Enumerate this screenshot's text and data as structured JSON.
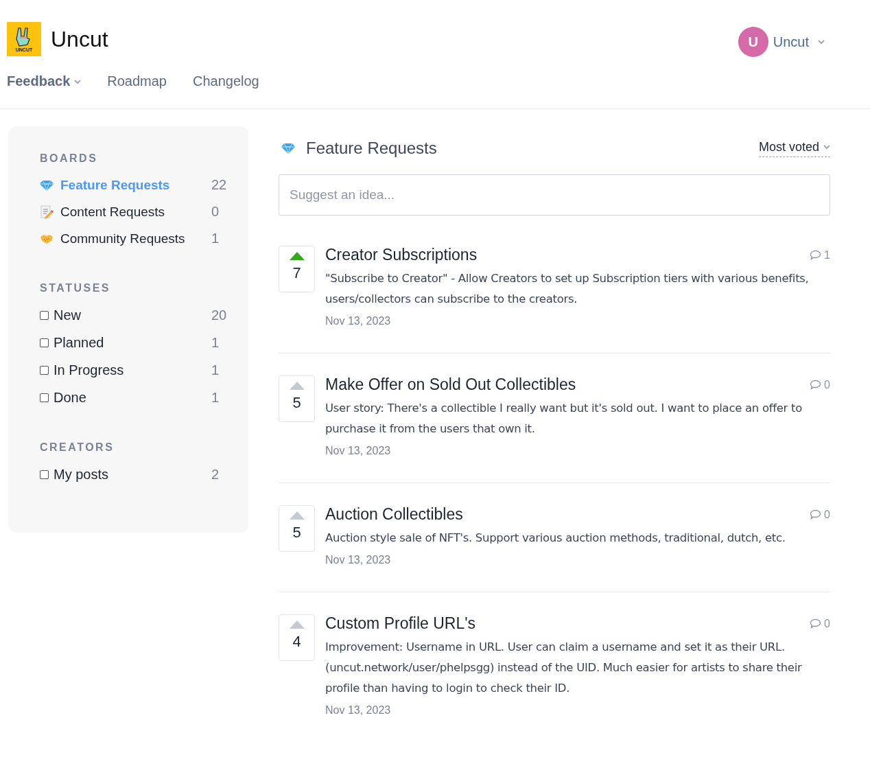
{
  "header": {
    "logo_text": "UNCUT",
    "title": "Uncut",
    "user": {
      "initial": "U",
      "name": "Uncut"
    }
  },
  "nav": [
    {
      "label": "Feedback",
      "selected": true,
      "dropdown": true
    },
    {
      "label": "Roadmap",
      "selected": false,
      "dropdown": false
    },
    {
      "label": "Changelog",
      "selected": false,
      "dropdown": false
    }
  ],
  "sidebar": {
    "sections": [
      {
        "title": "BOARDS",
        "kind": "board",
        "items": [
          {
            "label": "Feature Requests",
            "count": "22",
            "selected": true
          },
          {
            "label": "Content Requests",
            "count": "0",
            "selected": false
          },
          {
            "label": "Community Requests",
            "count": "1",
            "selected": false
          }
        ]
      },
      {
        "title": "STATUSES",
        "kind": "filter",
        "items": [
          {
            "label": "New",
            "count": "20",
            "checked": false
          },
          {
            "label": "Planned",
            "count": "1",
            "checked": false
          },
          {
            "label": "In Progress",
            "count": "1",
            "checked": false
          },
          {
            "label": "Done",
            "count": "1",
            "checked": false
          }
        ]
      },
      {
        "title": "CREATORS",
        "kind": "filter",
        "items": [
          {
            "label": "My posts",
            "count": "2",
            "checked": false
          }
        ]
      }
    ]
  },
  "board": {
    "title": "Feature Requests",
    "sort": "Most voted",
    "search": {
      "placeholder": "Suggest an idea..."
    }
  },
  "posts": [
    {
      "title": "Creator Subscriptions",
      "votes": "7",
      "voted": true,
      "comments": "1",
      "body": "\"Subscribe to Creator\" - Allow Creators to set up Subscription tiers with various benefits, users/collectors can subscribe to the creators.",
      "date": "Nov 13, 2023"
    },
    {
      "title": "Make Offer on Sold Out Collectibles",
      "votes": "5",
      "voted": false,
      "comments": "0",
      "body": "User story: There's a collectible I really want but it's sold out. I want to place an offer to purchase it from the users that own it.",
      "date": "Nov 13, 2023"
    },
    {
      "title": "Auction Collectibles",
      "votes": "5",
      "voted": false,
      "comments": "0",
      "body": "Auction style sale of NFT's. Support various auction methods, traditional, dutch, etc.",
      "date": "Nov 13, 2023"
    },
    {
      "title": "Custom Profile URL's",
      "votes": "4",
      "voted": false,
      "comments": "0",
      "body": "Improvement: Username in URL. User can claim a username and set it as their URL. (uncut.network/user/phelpsgg) instead of the UID. Much easier for artists to share their profile than having to login to check their ID.",
      "date": "Nov 13, 2023"
    }
  ]
}
